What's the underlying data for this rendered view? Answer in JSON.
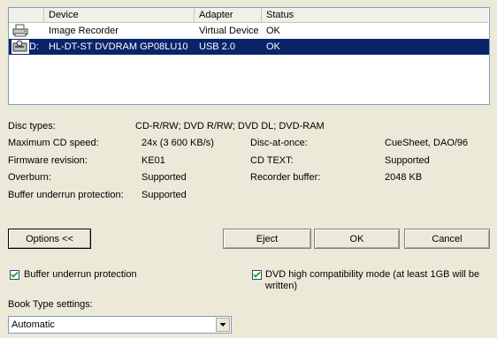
{
  "list": {
    "columns": {
      "device": "Device",
      "adapter": "Adapter",
      "status": "Status"
    },
    "rows": [
      {
        "letter": "",
        "device": "Image Recorder",
        "adapter": "Virtual Device",
        "status": "OK",
        "icon": "printer-icon",
        "selected": false
      },
      {
        "letter": "D:",
        "device": "HL-DT-ST DVDRAM GP08LU10",
        "adapter": "USB 2.0",
        "status": "OK",
        "icon": "optical-drive-icon",
        "selected": true
      }
    ]
  },
  "info": {
    "disc_types_label": "Disc types:",
    "disc_types_value": "CD-R/RW; DVD R/RW; DVD DL; DVD-RAM",
    "max_cd_speed_label": "Maximum CD speed:",
    "max_cd_speed_value": "24x (3 600 KB/s)",
    "firmware_label": "Firmware revision:",
    "firmware_value": "KE01",
    "overburn_label": "Overburn:",
    "overburn_value": "Supported",
    "buffer_label": "Buffer underrun protection:",
    "buffer_value": "Supported",
    "dao_label": "Disc-at-once:",
    "dao_value": "CueSheet, DAO/96",
    "cdtext_label": "CD TEXT:",
    "cdtext_value": "Supported",
    "recbuf_label": "Recorder buffer:",
    "recbuf_value": "2048 KB"
  },
  "buttons": {
    "options": "Options <<",
    "eject": "Eject",
    "ok": "OK",
    "cancel": "Cancel"
  },
  "options": {
    "buffer_underrun": {
      "label": "Buffer underrun protection",
      "checked": true
    },
    "dvd_compat": {
      "label_line1": "DVD high compatibility mode (at least 1GB will be",
      "label_line2": "written)",
      "checked": true
    },
    "book_type_label": "Book Type settings:",
    "book_type_value": "Automatic"
  }
}
